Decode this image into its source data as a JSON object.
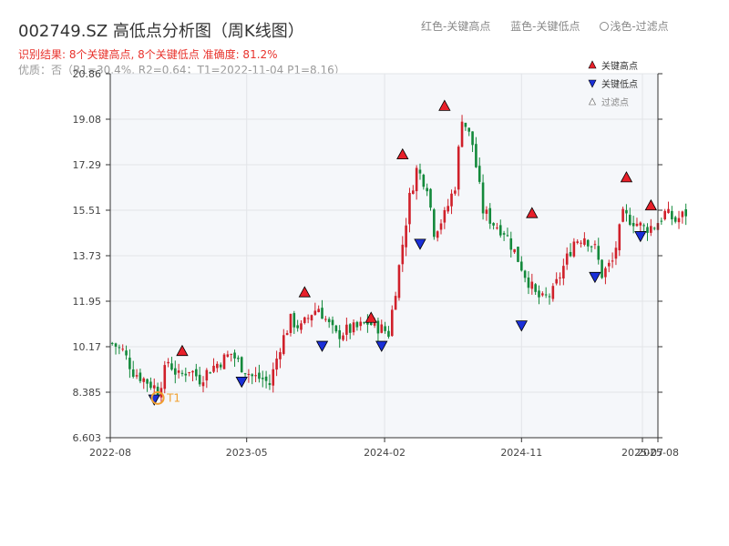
{
  "header": {
    "title": "002749.SZ 高低点分析图（周K线图）",
    "legend_red": "红色-关键高点",
    "legend_blue": "蓝色-关键低点",
    "legend_light": "浅色-过滤点",
    "result": "识别结果: 8个关键高点, 8个关键低点  准确度: 81.2%",
    "quality": "优质：否（R1=30.4%, R2=0.64；T1=2022-11-04 P1=8.16）"
  },
  "colors": {
    "up": "#d0202a",
    "down": "#13893b",
    "high_marker": "#e8202a",
    "low_marker": "#1a2fd8",
    "t1_marker": "#f0a030",
    "plot_bg": "#f5f7fa",
    "grid": "#e2e4e8",
    "axis": "#333333"
  },
  "chart_data": {
    "type": "candlestick",
    "title": "002749.SZ 高低点分析图（周K线图）",
    "x_tick_labels": [
      "2022-08",
      "2023-05",
      "2024-02",
      "2024-11",
      "2025-07",
      "2025-08"
    ],
    "x_tick_dates": [
      "2022-08-01",
      "2023-05-01",
      "2024-02-01",
      "2024-11-01",
      "2025-07-01",
      "2025-08-01"
    ],
    "x_range": [
      "2022-08-01",
      "2025-08-01"
    ],
    "y_tick_labels": [
      "6.603",
      "8.385",
      "10.17",
      "11.95",
      "13.73",
      "15.51",
      "17.29",
      "19.08",
      "20.86"
    ],
    "ylim": [
      6.603,
      20.86
    ],
    "grid": true,
    "close_series": [
      [
        "2022-08-05",
        10.3
      ],
      [
        "2022-08-26",
        10.0
      ],
      [
        "2022-09-16",
        9.2
      ],
      [
        "2022-10-07",
        8.9
      ],
      [
        "2022-10-28",
        8.6
      ],
      [
        "2022-11-04",
        8.4
      ],
      [
        "2022-11-25",
        9.6
      ],
      [
        "2022-12-16",
        9.0
      ],
      [
        "2023-01-06",
        9.3
      ],
      [
        "2023-01-27",
        8.9
      ],
      [
        "2023-02-17",
        9.3
      ],
      [
        "2023-03-10",
        9.6
      ],
      [
        "2023-03-31",
        9.9
      ],
      [
        "2023-04-21",
        9.4
      ],
      [
        "2023-05-12",
        9.0
      ],
      [
        "2023-06-02",
        8.9
      ],
      [
        "2023-06-16",
        8.7
      ],
      [
        "2023-07-07",
        10.2
      ],
      [
        "2023-07-28",
        11.2
      ],
      [
        "2023-08-18",
        10.9
      ],
      [
        "2023-09-08",
        11.5
      ],
      [
        "2023-09-22",
        11.7
      ],
      [
        "2023-10-13",
        11.0
      ],
      [
        "2023-10-27",
        10.6
      ],
      [
        "2023-11-17",
        10.8
      ],
      [
        "2023-12-08",
        10.9
      ],
      [
        "2023-12-29",
        11.1
      ],
      [
        "2024-01-12",
        11.0
      ],
      [
        "2024-02-02",
        10.8
      ],
      [
        "2024-02-09",
        10.7
      ],
      [
        "2024-03-01",
        13.3
      ],
      [
        "2024-03-22",
        16.0
      ],
      [
        "2024-04-05",
        17.1
      ],
      [
        "2024-04-26",
        16.5
      ],
      [
        "2024-05-10",
        14.7
      ],
      [
        "2024-05-31",
        15.3
      ],
      [
        "2024-06-21",
        16.5
      ],
      [
        "2024-07-05",
        19.2
      ],
      [
        "2024-07-26",
        18.1
      ],
      [
        "2024-08-16",
        15.5
      ],
      [
        "2024-09-06",
        15.0
      ],
      [
        "2024-09-27",
        14.7
      ],
      [
        "2024-10-18",
        13.9
      ],
      [
        "2024-11-08",
        13.0
      ],
      [
        "2024-11-29",
        12.2
      ],
      [
        "2024-12-13",
        12.0
      ],
      [
        "2025-01-03",
        12.3
      ],
      [
        "2025-01-24",
        13.3
      ],
      [
        "2025-02-14",
        14.3
      ],
      [
        "2025-03-07",
        14.5
      ],
      [
        "2025-03-28",
        14.0
      ],
      [
        "2025-04-11",
        13.0
      ],
      [
        "2025-05-02",
        13.5
      ],
      [
        "2025-05-23",
        15.3
      ],
      [
        "2025-06-13",
        15.1
      ],
      [
        "2025-07-04",
        14.8
      ],
      [
        "2025-07-25",
        14.9
      ],
      [
        "2025-08-15",
        15.4
      ],
      [
        "2025-09-05",
        15.1
      ],
      [
        "2025-09-26",
        15.4
      ]
    ],
    "key_highs": [
      {
        "date": "2022-12-23",
        "price": 10.0
      },
      {
        "date": "2023-08-25",
        "price": 12.3
      },
      {
        "date": "2024-01-05",
        "price": 11.3
      },
      {
        "date": "2024-03-08",
        "price": 17.7
      },
      {
        "date": "2024-05-31",
        "price": 19.6
      },
      {
        "date": "2024-11-22",
        "price": 15.4
      },
      {
        "date": "2025-05-30",
        "price": 16.8
      },
      {
        "date": "2025-07-18",
        "price": 15.7
      }
    ],
    "key_lows": [
      {
        "date": "2022-10-28",
        "price": 8.1
      },
      {
        "date": "2023-04-21",
        "price": 8.8
      },
      {
        "date": "2023-09-29",
        "price": 10.2
      },
      {
        "date": "2024-01-26",
        "price": 10.2
      },
      {
        "date": "2024-04-12",
        "price": 14.2
      },
      {
        "date": "2024-11-01",
        "price": 11.0
      },
      {
        "date": "2025-03-28",
        "price": 12.9
      },
      {
        "date": "2025-06-27",
        "price": 14.5
      }
    ],
    "t1_point": {
      "label": "T1",
      "date": "2022-11-04",
      "price": 8.16
    },
    "legend": {
      "position": "top-right",
      "entries": [
        {
          "key": "high",
          "label": "关键高点"
        },
        {
          "key": "low",
          "label": "关键低点"
        },
        {
          "key": "filtered",
          "label": "过滤点"
        }
      ]
    }
  }
}
